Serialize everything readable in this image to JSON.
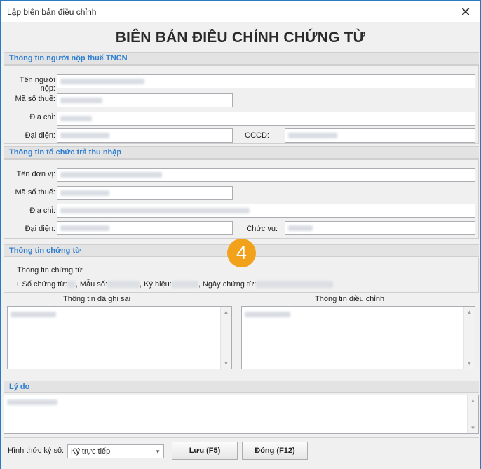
{
  "window": {
    "title": "Lập biên bản điều chỉnh",
    "close_glyph": "✕"
  },
  "main_title": "BIÊN BẢN ĐIỀU CHỈNH CHỨNG TỪ",
  "section_taxpayer": {
    "heading": "Thông tin người nộp thuế TNCN",
    "name_label": "Tên người nộp:",
    "tax_code_label": "Mã số thuế:",
    "address_label": "Địa chỉ:",
    "representative_label": "Đại diện:",
    "cccd_label": "CCCD:"
  },
  "section_payer": {
    "heading": "Thông tin tổ chức trả thu nhập",
    "unit_name_label": "Tên đơn vị:",
    "tax_code_label": "Mã số thuế:",
    "address_label": "Địa chỉ:",
    "representative_label": "Đại diện:",
    "position_label": "Chức vụ:"
  },
  "section_document": {
    "heading": "Thông tin chứng từ",
    "info_title": "Thông tin chứng từ",
    "line_prefix": "+ Số chứng từ:",
    "template_label": ", Mẫu số:",
    "symbol_label": ", Ký hiệu:",
    "date_label": ", Ngày chứng từ:",
    "wrong_info_label": "Thông tin đã ghi sai",
    "corrected_info_label": "Thông tin điều chỉnh"
  },
  "section_reason": {
    "heading": "Lý do"
  },
  "footer": {
    "sign_method_label": "Hình thức ký số:",
    "sign_method_value": "Ký trực tiếp",
    "save_button": "Lưu (F5)",
    "close_button": "Đóng (F12)"
  },
  "step_badge": "4",
  "icons": {
    "close": "close-icon",
    "scroll_up": "scroll-up-arrow-icon",
    "scroll_down": "scroll-down-arrow-icon",
    "dropdown": "chevron-down-icon"
  },
  "colors": {
    "section_heading": "#2f7fd0",
    "window_border": "#2b79c2",
    "badge": "#f2a21a"
  }
}
